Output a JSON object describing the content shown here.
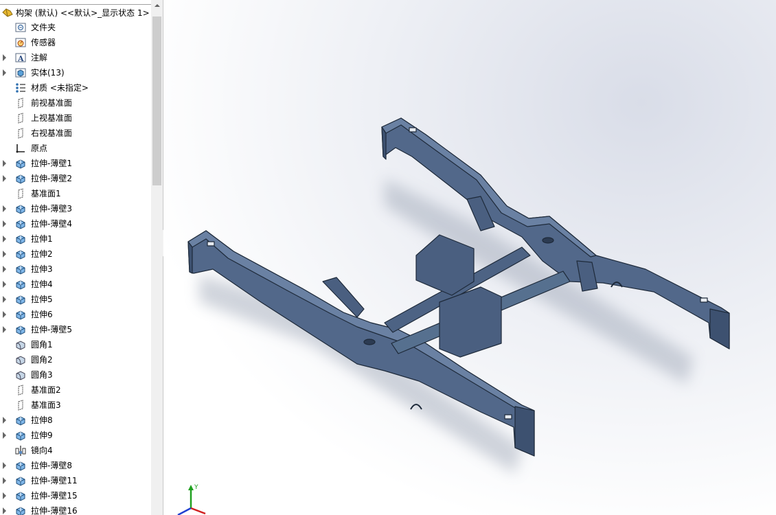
{
  "tree": {
    "root_label": "构架 (默认) <<默认>_显示状态 1>",
    "items": [
      {
        "label": "文件夹",
        "icon": "folder-icon",
        "expandable": false
      },
      {
        "label": "传感器",
        "icon": "sensor-icon",
        "expandable": false
      },
      {
        "label": "注解",
        "icon": "annotation-icon",
        "expandable": true
      },
      {
        "label": "实体(13)",
        "icon": "solid-bodies-icon",
        "expandable": true
      },
      {
        "label": "材质 <未指定>",
        "icon": "material-icon",
        "expandable": false
      },
      {
        "label": "前视基准面",
        "icon": "plane-icon",
        "expandable": false
      },
      {
        "label": "上视基准面",
        "icon": "plane-icon",
        "expandable": false
      },
      {
        "label": "右视基准面",
        "icon": "plane-icon",
        "expandable": false
      },
      {
        "label": "原点",
        "icon": "origin-icon",
        "expandable": false
      },
      {
        "label": "拉伸-薄壁1",
        "icon": "extrude-icon",
        "expandable": true
      },
      {
        "label": "拉伸-薄壁2",
        "icon": "extrude-icon",
        "expandable": true
      },
      {
        "label": "基准面1",
        "icon": "plane-icon",
        "expandable": false
      },
      {
        "label": "拉伸-薄壁3",
        "icon": "extrude-icon",
        "expandable": true
      },
      {
        "label": "拉伸-薄壁4",
        "icon": "extrude-icon",
        "expandable": true
      },
      {
        "label": "拉伸1",
        "icon": "extrude-icon",
        "expandable": true
      },
      {
        "label": "拉伸2",
        "icon": "extrude-icon",
        "expandable": true
      },
      {
        "label": "拉伸3",
        "icon": "extrude-icon",
        "expandable": true
      },
      {
        "label": "拉伸4",
        "icon": "extrude-icon",
        "expandable": true
      },
      {
        "label": "拉伸5",
        "icon": "extrude-icon",
        "expandable": true
      },
      {
        "label": "拉伸6",
        "icon": "extrude-icon",
        "expandable": true
      },
      {
        "label": "拉伸-薄壁5",
        "icon": "extrude-icon",
        "expandable": true
      },
      {
        "label": "圆角1",
        "icon": "fillet-icon",
        "expandable": false
      },
      {
        "label": "圆角2",
        "icon": "fillet-icon",
        "expandable": false
      },
      {
        "label": "圆角3",
        "icon": "fillet-icon",
        "expandable": false
      },
      {
        "label": "基准面2",
        "icon": "plane-icon",
        "expandable": false
      },
      {
        "label": "基准面3",
        "icon": "plane-icon",
        "expandable": false
      },
      {
        "label": "拉伸8",
        "icon": "extrude-icon",
        "expandable": true
      },
      {
        "label": "拉伸9",
        "icon": "extrude-icon",
        "expandable": true
      },
      {
        "label": "镜向4",
        "icon": "mirror-icon",
        "expandable": false
      },
      {
        "label": "拉伸-薄壁8",
        "icon": "extrude-icon",
        "expandable": true
      },
      {
        "label": "拉伸-薄壁11",
        "icon": "extrude-icon",
        "expandable": true
      },
      {
        "label": "拉伸-薄壁15",
        "icon": "extrude-icon",
        "expandable": true
      },
      {
        "label": "拉伸-薄壁16",
        "icon": "extrude-icon",
        "expandable": true
      }
    ]
  },
  "colors": {
    "model": "#4a6080",
    "model_edge": "#1e2a3a",
    "triad_x": "#d02020",
    "triad_y": "#20a020",
    "triad_z": "#2040d0"
  },
  "triad": {
    "y_label": "Y"
  }
}
